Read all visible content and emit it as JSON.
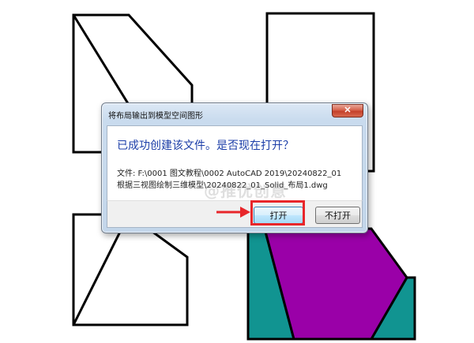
{
  "dialog": {
    "title": "将布局输出到模型空间图形",
    "close_label": "✕",
    "main_instruction": "已成功创建该文件。是否现在打开？",
    "detail_line_1": "文件: F:\\0001 图文教程\\0002 AutoCAD 2019\\20240822_01",
    "detail_line_2": "根据三视图绘制三维模型\\20240822_01_Solid_布局1.dwg",
    "open_button_label": "打开",
    "notopen_button_label": "不打开"
  },
  "watermark": {
    "text": "@推优创意"
  },
  "colors": {
    "instruction_blue": "#1c3ea8",
    "highlight_red": "#e8262a",
    "cad_purple": "#9a00a8",
    "cad_teal": "#119491"
  }
}
